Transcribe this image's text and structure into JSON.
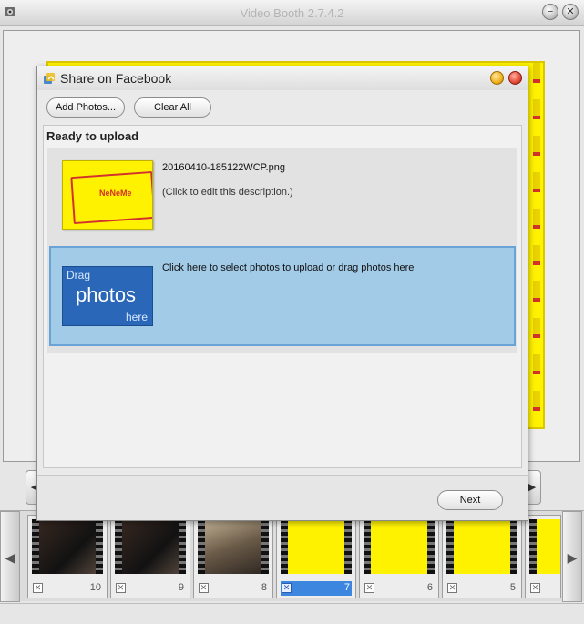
{
  "app": {
    "title": "Video Booth  2.7.4.2",
    "minimize_glyph": "−",
    "close_glyph": "✕",
    "icon": "webcam-icon"
  },
  "navigation": {
    "left_arrow": "◀",
    "right_arrow": "▶"
  },
  "filmstrip": {
    "left_arrow": "◀",
    "right_arrow": "▶",
    "thumbnails": [
      {
        "number": "10",
        "style": "dark"
      },
      {
        "number": "9",
        "style": "dark"
      },
      {
        "number": "8",
        "style": "room"
      },
      {
        "number": "7",
        "style": "yellow",
        "selected": true
      },
      {
        "number": "6",
        "style": "yellow"
      },
      {
        "number": "5",
        "style": "yellow"
      },
      {
        "number": "",
        "style": "yellow"
      }
    ],
    "remove_glyph": "✕"
  },
  "dialog": {
    "title": "Share on Facebook",
    "add_photos_label": "Add Photos...",
    "clear_all_label": "Clear All",
    "section_heading": "Ready to upload",
    "photo": {
      "filename": "20160410-185122WCP.png",
      "description": "(Click to edit this description.)",
      "logo_text": "NeNeMe"
    },
    "drop_zone": {
      "instruction": "Click here to select photos to upload or drag photos here",
      "icon_words": [
        "Drag",
        "photos",
        "here"
      ]
    },
    "next_label": "Next",
    "colors": {
      "drop_zone_bg": "#a2cbe8",
      "drop_icon_bg": "#2a67b8"
    }
  }
}
